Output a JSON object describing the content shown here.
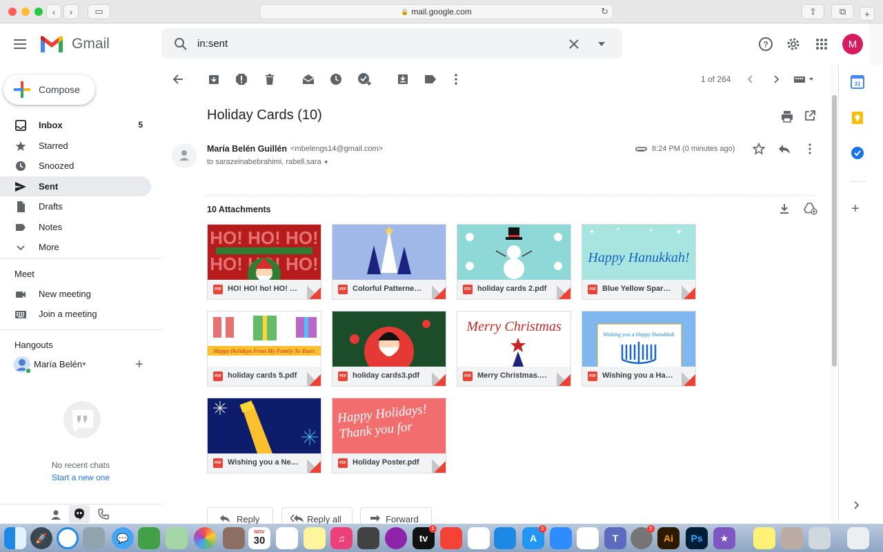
{
  "browser": {
    "url": "mail.google.com"
  },
  "header": {
    "app_name": "Gmail",
    "search_query": "in:sent",
    "avatar_letter": "M"
  },
  "compose_label": "Compose",
  "nav": [
    {
      "label": "Inbox",
      "count": "5",
      "icon": "inbox-icon"
    },
    {
      "label": "Starred",
      "count": "",
      "icon": "star-icon"
    },
    {
      "label": "Snoozed",
      "count": "",
      "icon": "clock-icon"
    },
    {
      "label": "Sent",
      "count": "",
      "icon": "send-icon",
      "active": true
    },
    {
      "label": "Drafts",
      "count": "",
      "icon": "draft-icon"
    },
    {
      "label": "Notes",
      "count": "",
      "icon": "label-icon"
    },
    {
      "label": "More",
      "count": "",
      "icon": "chevron-down-icon"
    }
  ],
  "meet": {
    "heading": "Meet",
    "new_meeting": "New meeting",
    "join_meeting": "Join a meeting"
  },
  "hangouts": {
    "heading": "Hangouts",
    "user": "María Belén",
    "no_chats": "No recent chats",
    "start_new": "Start a new one"
  },
  "toolbar": {
    "pagination": "1 of 264"
  },
  "message": {
    "subject": "Holiday Cards (10)",
    "sender_name": "María Belén Guillén",
    "sender_email": "<mbelengs14@gmail.com>",
    "to": "to sarazeinabebrahimi, rabell.sara",
    "time": "8:24 PM (0 minutes ago)"
  },
  "attachments": {
    "heading": "10 Attachments",
    "files": [
      {
        "name": "HO! HO! ho! HO! H...",
        "thumb_text": "HO! HO! HO!",
        "bg": "#b71c1c"
      },
      {
        "name": "Colorful Patterned ...",
        "thumb_text": "",
        "bg": "#9fb8e8"
      },
      {
        "name": "holiday cards 2.pdf",
        "thumb_text": "",
        "bg": "#8fd8d8"
      },
      {
        "name": "Blue Yellow Sparkl...",
        "thumb_text": "Happy Hanukkah!",
        "bg": "#a8e4e0"
      },
      {
        "name": "holiday cards 5.pdf",
        "thumb_text": "Happy Holidays From My Family To Yours",
        "bg": "#ffffff"
      },
      {
        "name": "holiday cards3.pdf",
        "thumb_text": "",
        "bg": "#1b4d2b"
      },
      {
        "name": "Merry Christmas.pdf",
        "thumb_text": "Merry Christmas",
        "bg": "#ffffff"
      },
      {
        "name": "Wishing you a Hap...",
        "thumb_text": "Wishing you a Happy Hanukkah",
        "bg": "#7fb7ee"
      },
      {
        "name": "Wishing you a New ...",
        "thumb_text": "",
        "bg": "#0d1c6b"
      },
      {
        "name": "Holiday Poster.pdf",
        "thumb_text": "Happy Holidays! Thank you for",
        "bg": "#f26d6d"
      }
    ]
  },
  "actions": {
    "reply": "Reply",
    "reply_all": "Reply all",
    "forward": "Forward"
  },
  "dock": {
    "calendar_month": "NOV",
    "calendar_day": "30",
    "badge": "1"
  }
}
